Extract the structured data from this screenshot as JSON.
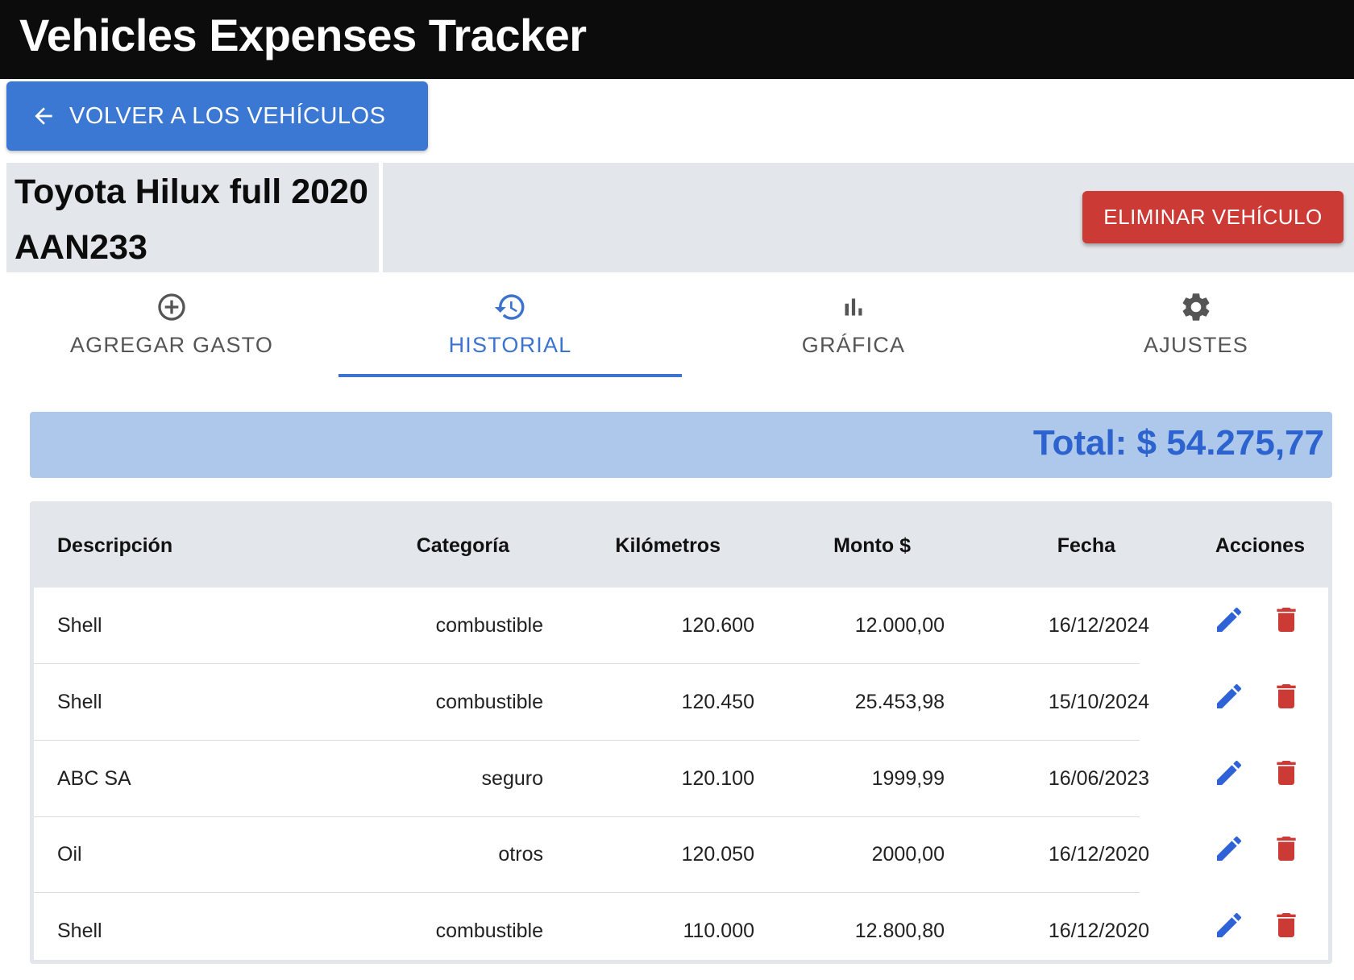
{
  "app": {
    "title": "Vehicles Expenses Tracker"
  },
  "nav": {
    "back_label": "VOLVER A LOS VEHÍCULOS"
  },
  "vehicle": {
    "name": "Toyota Hilux full 2020",
    "plate": "AAN233",
    "delete_label": "ELIMINAR VEHÍCULO"
  },
  "tabs": [
    {
      "label": "AGREGAR GASTO",
      "icon": "add-circle-icon",
      "active": false
    },
    {
      "label": "HISTORIAL",
      "icon": "history-icon",
      "active": true
    },
    {
      "label": "GRÁFICA",
      "icon": "bar-chart-icon",
      "active": false
    },
    {
      "label": "AJUSTES",
      "icon": "gear-icon",
      "active": false
    }
  ],
  "summary": {
    "total_label": "Total: $ 54.275,77"
  },
  "table": {
    "headers": {
      "description": "Descripción",
      "category": "Categoría",
      "kilometers": "Kilómetros",
      "amount": "Monto $",
      "date": "Fecha",
      "actions": "Acciones"
    },
    "rows": [
      {
        "description": "Shell",
        "category": "combustible",
        "kilometers": "120.600",
        "amount": "12.000,00",
        "date": "16/12/2024"
      },
      {
        "description": "Shell",
        "category": "combustible",
        "kilometers": "120.450",
        "amount": "25.453,98",
        "date": "15/10/2024"
      },
      {
        "description": "ABC SA",
        "category": "seguro",
        "kilometers": "120.100",
        "amount": "1999,99",
        "date": "16/06/2023"
      },
      {
        "description": "Oil",
        "category": "otros",
        "kilometers": "120.050",
        "amount": "2000,00",
        "date": "16/12/2020"
      },
      {
        "description": "Shell",
        "category": "combustible",
        "kilometers": "110.000",
        "amount": "12.800,80",
        "date": "16/12/2020"
      }
    ]
  },
  "colors": {
    "header_bg": "#0c0c0c",
    "primary": "#3b78d3",
    "danger": "#cc3a36",
    "panel_bg": "#e3e6ea",
    "total_bg": "#adc8eb",
    "total_text": "#2c63cf",
    "edit_icon": "#2f62d6",
    "delete_icon": "#cc3a36"
  }
}
